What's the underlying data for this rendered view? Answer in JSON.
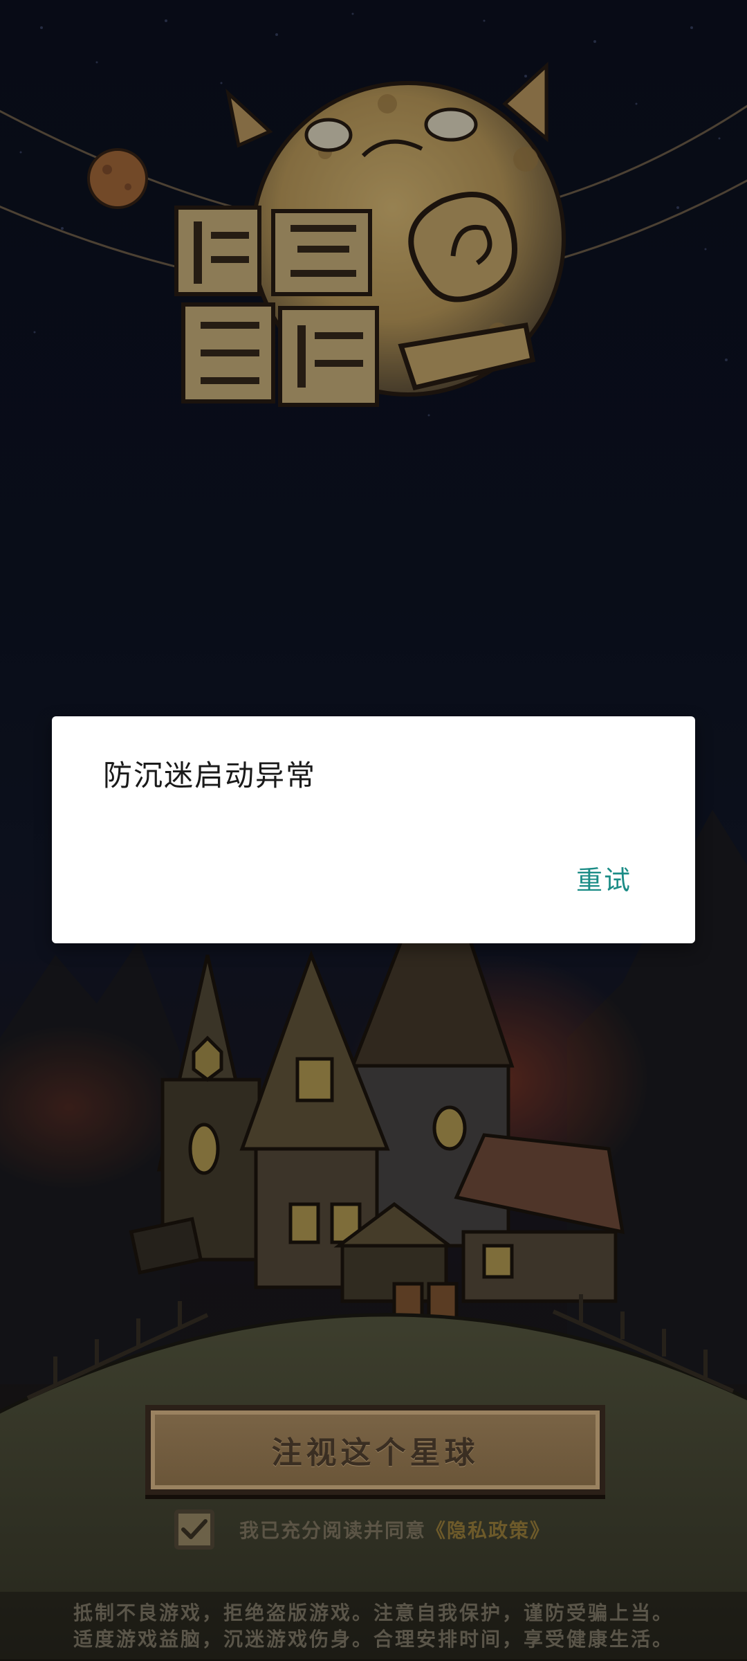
{
  "dialog": {
    "title": "防沉迷启动异常",
    "retry_label": "重试"
  },
  "start_button": {
    "label": "注视这个星球"
  },
  "agreement": {
    "checked": true,
    "text": "我已充分阅读并同意",
    "link_label": "《隐私政策》"
  },
  "notice": {
    "line1": "抵制不良游戏，拒绝盗版游戏。注意自我保护，谨防受骗上当。",
    "line2": "适度游戏益脑，沉迷游戏伤身。合理安排时间，享受健康生活。"
  },
  "icons": {
    "agreement_checkbox": "checkmark-icon",
    "game_logo": "game-logo-planet"
  },
  "colors": {
    "dialog_accent": "#1b8c86",
    "logo_gold": "#c9a662",
    "background": "#0d1222"
  }
}
